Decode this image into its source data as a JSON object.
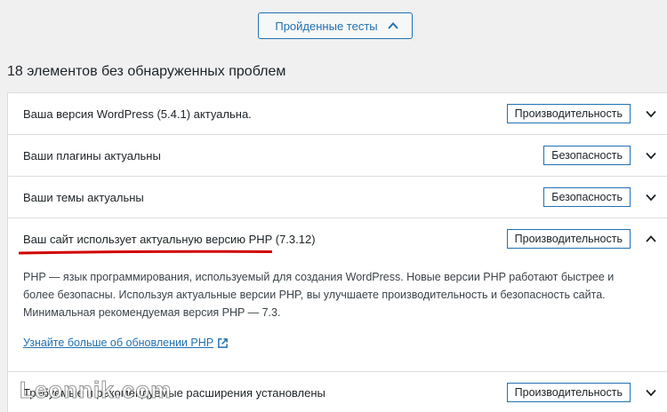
{
  "toggle": {
    "label": "Пройденные тесты",
    "icon": "chevron-up-icon"
  },
  "summary": "18 элементов без обнаруженных проблем",
  "colors": {
    "accent": "#2271b1",
    "highlight": "#d10000"
  },
  "items": [
    {
      "title": "Ваша версия WordPress (5.4.1) актуальна.",
      "badge": "Производительность",
      "expanded": false
    },
    {
      "title": "Ваши плагины актуальны",
      "badge": "Безопасность",
      "expanded": false
    },
    {
      "title": "Ваши темы актуальны",
      "badge": "Безопасность",
      "expanded": false
    },
    {
      "title": "Ваш сайт использует актуальную версию PHP (7.3.12)",
      "badge": "Производительность",
      "expanded": true,
      "description": "PHP — язык программирования, используемый для создания WordPress. Новые версии PHP работают быстрее и более безопасны. Используя актуальные версии PHP, вы улучшаете производительность и безопасность сайта. Минимальная рекомендуемая версия PHP — 7.3.",
      "link": "Узнайте больше об обновлении PHP"
    },
    {
      "title": "Требуемые и рекомендуемые расширения установлены",
      "badge": "Производительность",
      "expanded": false
    }
  ],
  "watermark": "Leonnik.com"
}
